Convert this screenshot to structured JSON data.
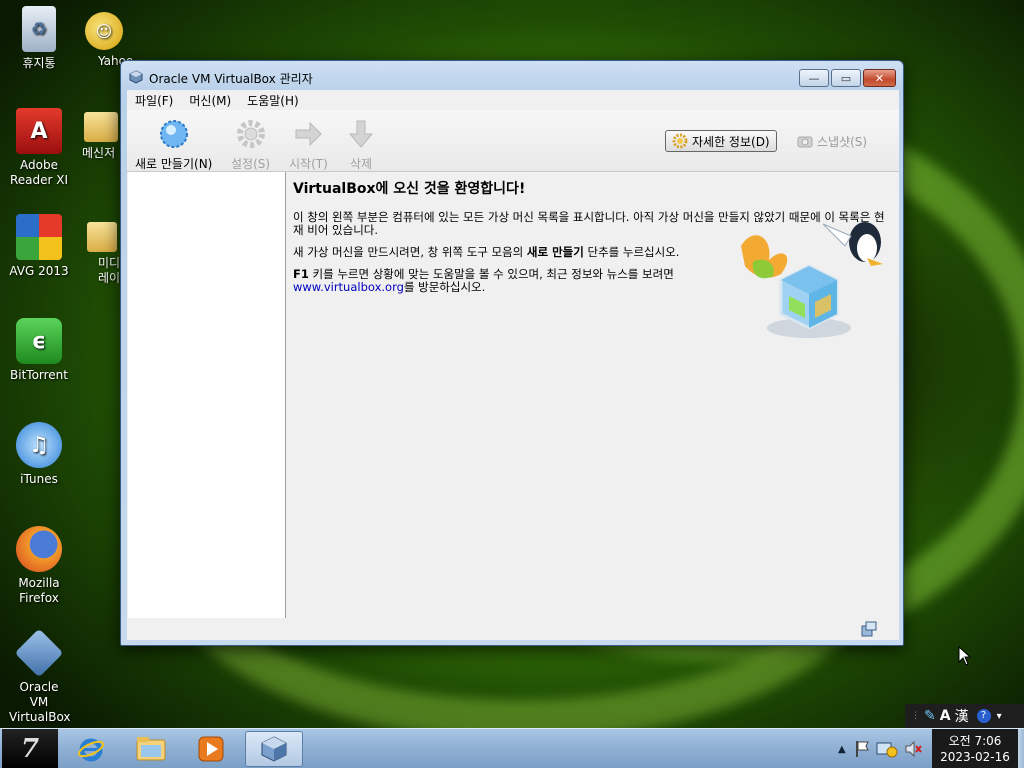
{
  "desktop": {
    "icons": [
      {
        "label": "휴지통",
        "icon": "recycle-bin-icon"
      },
      {
        "label": "Yahoo! Messenger",
        "icon": "yahoo-messenger-icon"
      },
      {
        "label": "Adobe Reader XI",
        "icon": "adobe-reader-icon"
      },
      {
        "label": "메신저",
        "icon": "folder-icon"
      },
      {
        "label": "AVG 2013",
        "icon": "avg-icon"
      },
      {
        "label": "미디어 플레이어",
        "icon": "folder-icon"
      },
      {
        "label": "BitTorrent",
        "icon": "bittorrent-icon"
      },
      {
        "label": "iTunes",
        "icon": "itunes-icon"
      },
      {
        "label": "Mozilla Firefox",
        "icon": "firefox-icon"
      },
      {
        "label": "Oracle VM VirtualBox",
        "icon": "virtualbox-icon"
      }
    ]
  },
  "window": {
    "title": "Oracle VM VirtualBox 관리자",
    "menu": [
      "파일(F)",
      "머신(M)",
      "도움말(H)"
    ],
    "toolbar": {
      "new": "새로 만들기(N)",
      "settings": "설정(S)",
      "start": "시작(T)",
      "delete": "삭제",
      "details": "자세한 정보(D)",
      "snapshots": "스냅샷(S)"
    },
    "welcome": {
      "title": "VirtualBox에 오신 것을 환영합니다!",
      "p1": "이 창의 왼쪽 부분은 컴퓨터에 있는 모든 가상 머신 목록을 표시합니다. 아직 가상 머신을 만들지 않았기 때문에 이 목록은 현재 비어 있습니다.",
      "p2_a": "새 가상 머신을 만드시려면, 창 위쪽 도구 모음의 ",
      "p2_b": "새로 만들기",
      "p2_c": " 단추를 누르십시오.",
      "p3_a": "F1",
      "p3_b": " 키를 누르면 상황에 맞는 도움말을 볼 수 있으며, 최근 정보와 뉴스를 보려면 ",
      "p3_link": "www.virtualbox.org",
      "p3_c": "를 방문하십시오."
    }
  },
  "taskbar": {
    "clock_time": "오전 7:06",
    "clock_date": "2023-02-16",
    "ime_mode": "A",
    "ime_hanja": "漢"
  },
  "colors": {
    "link": "#0000c0",
    "taskbar": "#8fb0d3",
    "close_button": "#c24a2a"
  }
}
